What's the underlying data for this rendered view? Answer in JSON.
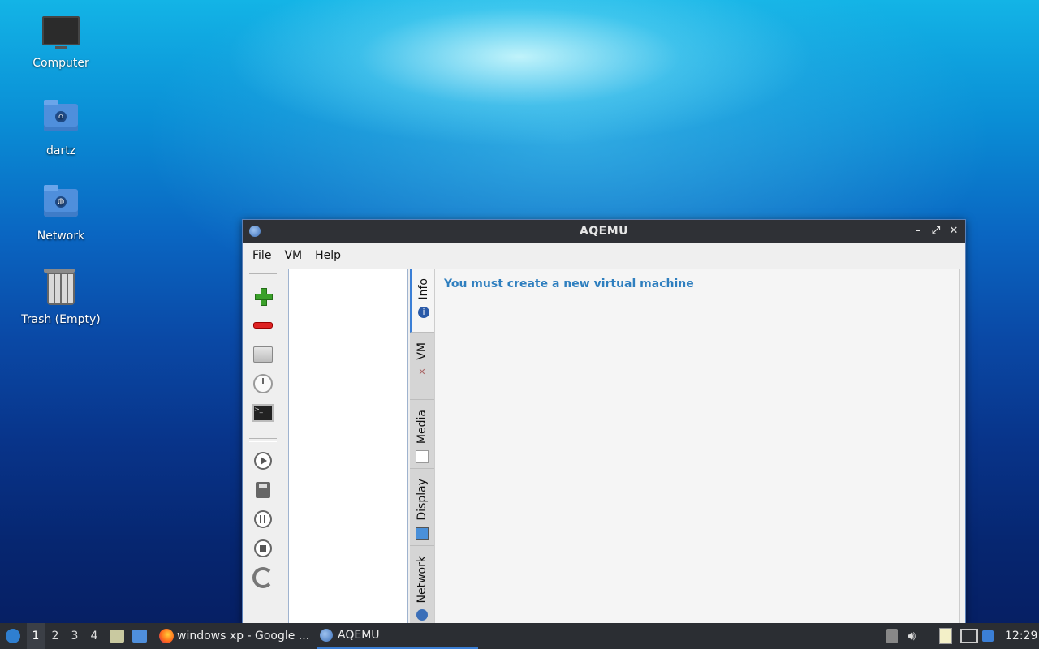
{
  "desktop": {
    "icons": [
      {
        "label": "Computer",
        "icon": "computer-icon"
      },
      {
        "label": "dartz",
        "icon": "home-folder-icon"
      },
      {
        "label": "Network",
        "icon": "network-folder-icon"
      },
      {
        "label": "Trash (Empty)",
        "icon": "trash-icon"
      }
    ]
  },
  "window": {
    "title": "AQEMU",
    "menu": [
      "File",
      "VM",
      "Help"
    ],
    "controls": {
      "minimize": "–",
      "maximize": "⤢",
      "close": "✕"
    },
    "tabs": [
      {
        "label": "Info",
        "icon": "info-icon"
      },
      {
        "label": "VM",
        "icon": "tools-icon"
      },
      {
        "label": "Media",
        "icon": "media-icon"
      },
      {
        "label": "Display",
        "icon": "display-icon"
      },
      {
        "label": "Network",
        "icon": "network-icon"
      }
    ],
    "message": "You must create a new virtual machine"
  },
  "taskbar": {
    "workspaces": [
      "1",
      "2",
      "3",
      "4"
    ],
    "tasks": [
      {
        "label": "windows xp - Google ..."
      },
      {
        "label": "AQEMU"
      }
    ],
    "clock": "12:29"
  },
  "colors": {
    "accent": "#3b7fd6",
    "message": "#2f7fbf"
  }
}
